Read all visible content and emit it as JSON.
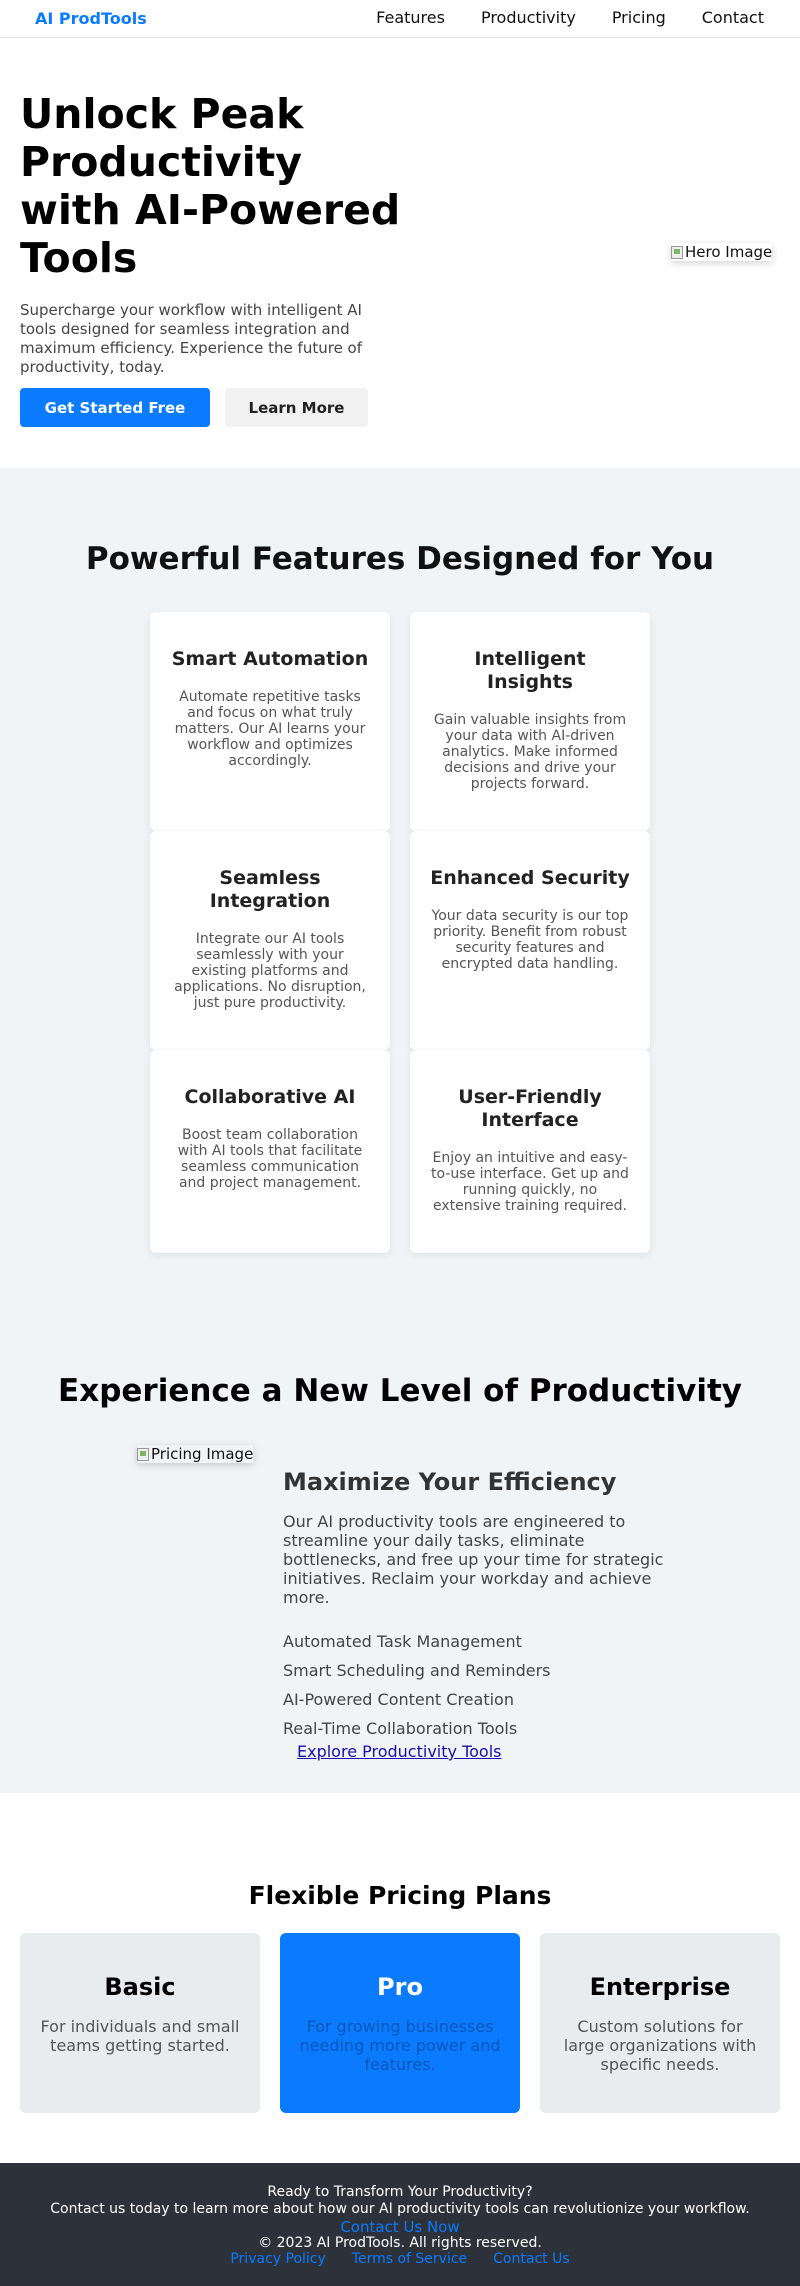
{
  "header": {
    "logo": "AI ProdTools",
    "nav": [
      "Features",
      "Productivity",
      "Pricing",
      "Contact"
    ]
  },
  "hero": {
    "title": "Unlock Peak Productivity with AI-Powered Tools",
    "subtitle": "Supercharge your workflow with intelligent AI tools designed for seamless integration and maximum efficiency. Experience the future of productivity, today.",
    "primary_cta": "Get Started Free",
    "secondary_cta": "Learn More",
    "image_alt": "Hero Image"
  },
  "features": {
    "heading": "Powerful Features Designed for You",
    "cards": [
      {
        "title": "Smart Automation",
        "text": "Automate repetitive tasks and focus on what truly matters. Our AI learns your workflow and optimizes accordingly."
      },
      {
        "title": "Intelligent Insights",
        "text": "Gain valuable insights from your data with AI-driven analytics. Make informed decisions and drive your projects forward."
      },
      {
        "title": "Seamless Integration",
        "text": "Integrate our AI tools seamlessly with your existing platforms and applications. No disruption, just pure productivity."
      },
      {
        "title": "Enhanced Security",
        "text": "Your data security is our top priority. Benefit from robust security features and encrypted data handling."
      },
      {
        "title": "Collaborative AI",
        "text": "Boost team collaboration with AI tools that facilitate seamless communication and project management."
      },
      {
        "title": "User-Friendly Interface",
        "text": "Enjoy an intuitive and easy-to-use interface. Get up and running quickly, no extensive training required."
      }
    ]
  },
  "productivity": {
    "heading": "Experience a New Level of Productivity",
    "image_alt": "Pricing Image",
    "subheading": "Maximize Your Efficiency",
    "text": "Our AI productivity tools are engineered to streamline your daily tasks, eliminate bottlenecks, and free up your time for strategic initiatives. Reclaim your workday and achieve more.",
    "list": [
      "Automated Task Management",
      "Smart Scheduling and Reminders",
      "AI-Powered Content Creation",
      "Real-Time Collaboration Tools"
    ],
    "link": "Explore Productivity Tools"
  },
  "pricing": {
    "heading": "Flexible Pricing Plans",
    "plans": [
      {
        "name": "Basic",
        "text": "For individuals and small teams getting started."
      },
      {
        "name": "Pro",
        "text": "For growing businesses needing more power and features."
      },
      {
        "name": "Enterprise",
        "text": "Custom solutions for large organizations with specific needs."
      }
    ]
  },
  "footer": {
    "title": "Ready to Transform Your Productivity?",
    "text": "Contact us today to learn more about how our AI productivity tools can revolutionize your workflow.",
    "contact_link": "Contact Us Now",
    "copyright": "© 2023 AI ProdTools. All rights reserved.",
    "links": [
      "Privacy Policy",
      "Terms of Service",
      "Contact Us"
    ]
  },
  "colors": {
    "accent": "#0a7bff",
    "section_bg": "#f1f4f7",
    "footer_bg": "#2d3139"
  }
}
